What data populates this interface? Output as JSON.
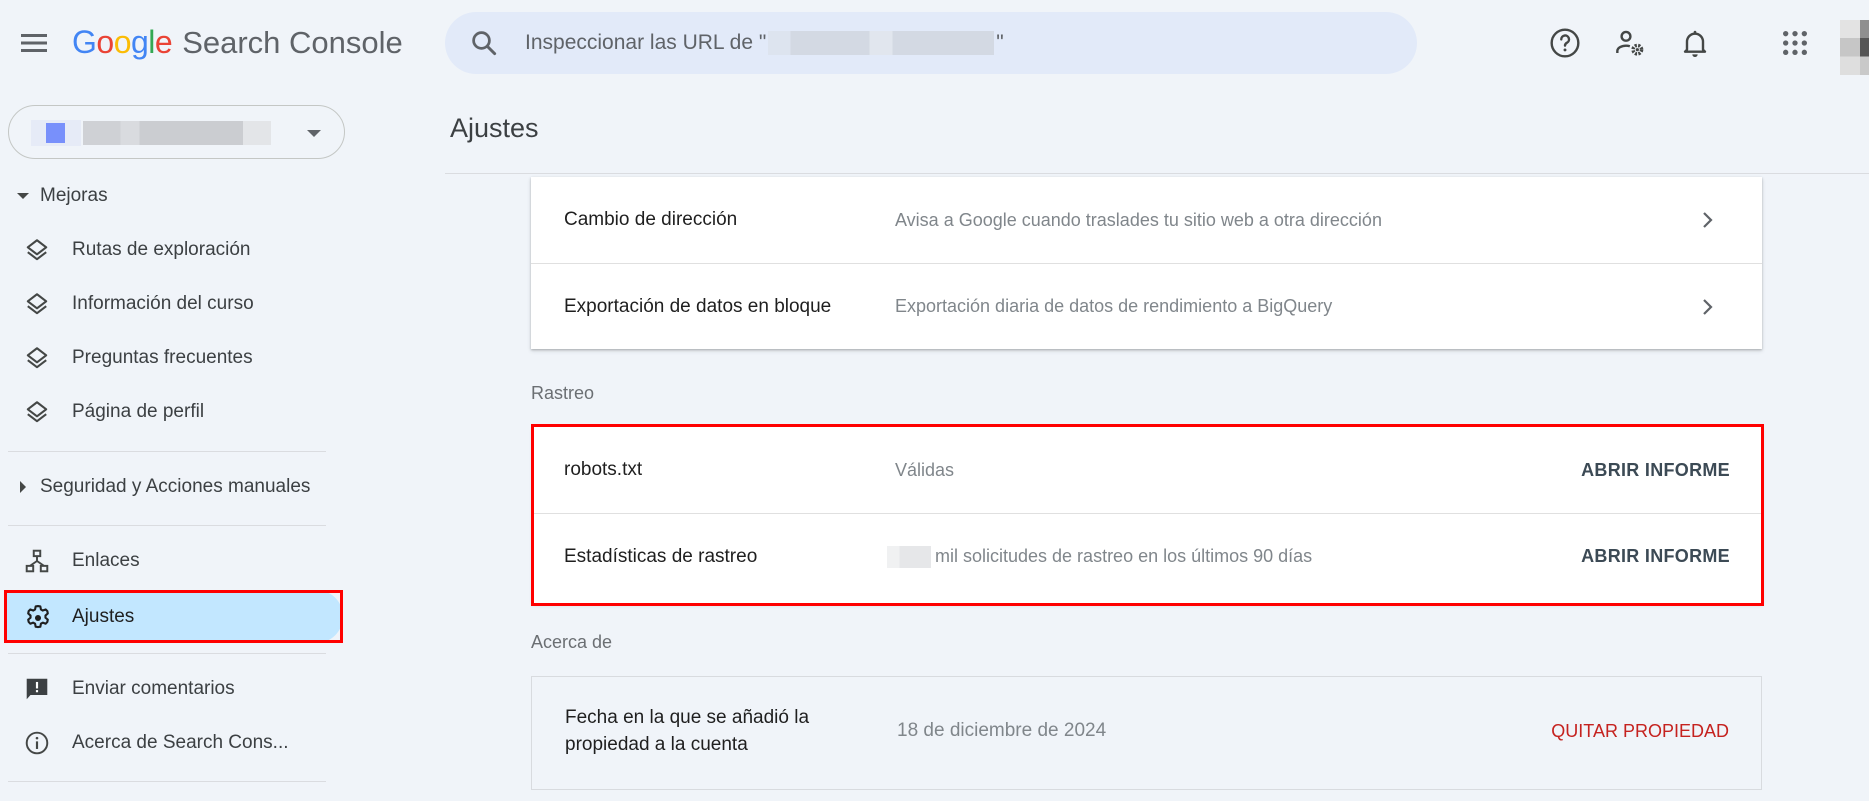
{
  "header": {
    "logo_google": [
      "G",
      "o",
      "o",
      "g",
      "l",
      "e"
    ],
    "logo_colors": [
      "#4285f4",
      "#ea4335",
      "#fbbc05",
      "#4285f4",
      "#34a853",
      "#ea4335"
    ],
    "logo_product": "Search Console",
    "search_placeholder_prefix": "Inspeccionar las URL de \"",
    "search_placeholder_suffix": "\"",
    "icons": [
      "help-icon",
      "admin-settings-icon",
      "notifications-icon",
      "apps-icon"
    ]
  },
  "sidebar": {
    "property_selector": {
      "icon_color": "#7890fb"
    },
    "sections": {
      "mejoras": "Mejoras",
      "seguridad": "Seguridad y Acciones manuales"
    },
    "mejoras_items": [
      {
        "label": "Rutas de exploración",
        "icon": "layers-icon"
      },
      {
        "label": "Información del curso",
        "icon": "layers-icon"
      },
      {
        "label": "Preguntas frecuentes",
        "icon": "layers-icon"
      },
      {
        "label": "Página de perfil",
        "icon": "layers-icon"
      }
    ],
    "enlaces": "Enlaces",
    "ajustes": "Ajustes",
    "enviar_comentarios": "Enviar comentarios",
    "acerca": "Acerca de Search Cons...",
    "active_item": "Ajustes",
    "active_color": "#c2e7ff"
  },
  "main": {
    "title": "Ajustes",
    "general_rows": [
      {
        "label": "Cambio de dirección",
        "description": "Avisa a Google cuando traslades tu sitio web a otra dirección"
      },
      {
        "label": "Exportación de datos en bloque",
        "description": "Exportación diaria de datos de rendimiento a BigQuery"
      }
    ],
    "rastreo": {
      "heading": "Rastreo",
      "rows": [
        {
          "label": "robots.txt",
          "description": "Válidas",
          "action": "ABRIR INFORME"
        },
        {
          "label": "Estadísticas de rastreo",
          "description": "mil solicitudes de rastreo en los últimos 90 días",
          "action": "ABRIR INFORME"
        }
      ]
    },
    "acerca": {
      "heading": "Acerca de",
      "label": "Fecha en la que se añadió la propiedad a la cuenta",
      "value": "18 de diciembre de 2024",
      "action": "QUITAR PROPIEDAD",
      "action_color": "#c5221f"
    },
    "highlight_color": "#ff0000"
  }
}
